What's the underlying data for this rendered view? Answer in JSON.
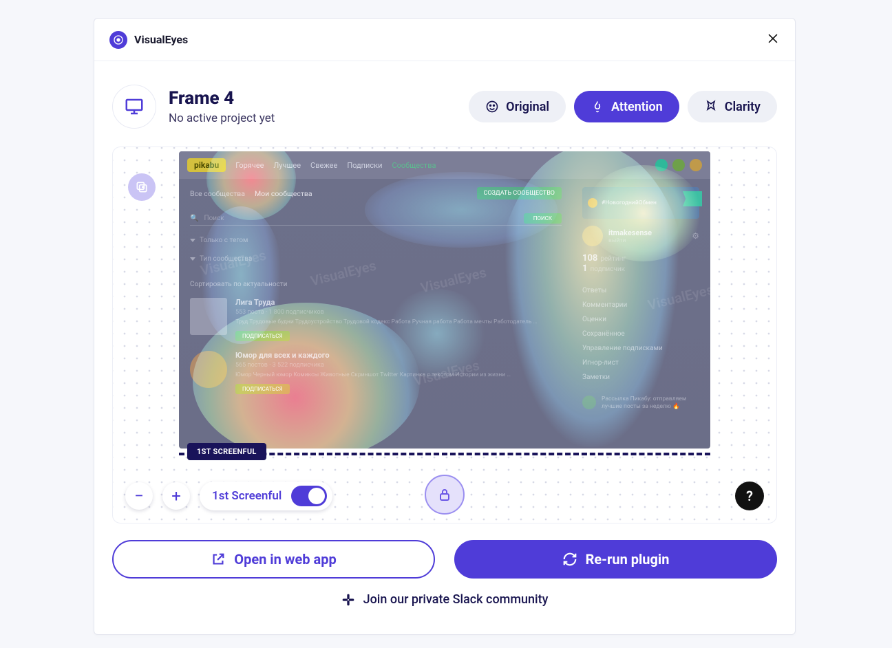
{
  "app": {
    "name": "VisualEyes"
  },
  "header": {
    "title": "Frame 4",
    "subtitle": "No active project yet"
  },
  "tabs": {
    "original": "Original",
    "attention": "Attention",
    "clarity": "Clarity",
    "active": "attention"
  },
  "preview": {
    "screenful_badge": "1ST SCREENFUL",
    "screenful_toggle_label": "1st Screenful",
    "site": {
      "brand": "pikabu",
      "top_nav": [
        "Горячее",
        "Лучшее",
        "Свежее",
        "Подписки",
        "Сообщества"
      ],
      "subnav": {
        "all": "Все сообщества",
        "mine": "Мои сообщества",
        "create": "СОЗДАТЬ СООБЩЕСТВО"
      },
      "search_placeholder": "Поиск",
      "search_btn": "ПОИСК",
      "filters": [
        "Только с тегом",
        "Тип сообщества"
      ],
      "sort": "Сортировать по актуальности",
      "cards": [
        {
          "title": "Лига Труда",
          "meta": "553 поста · 1 800 подписчиков",
          "tags": "Труд   Трудовые будни   Трудоустройство   Трудовой кодекс   Работа   Ручная работа   Работа мечты   Работодатель   …",
          "btn": "ПОДПИСАТЬСЯ"
        },
        {
          "title": "Юмор для всех и каждого",
          "meta": "565 постов · 3 522 подписчика",
          "tags": "Юмор   Черный юмор   Комиксы   Животные   Скриншот   Twitter   Картинка с текстом   Истории из жизни   …",
          "btn": "ПОДПИСАТЬСЯ"
        }
      ],
      "right": {
        "banner": "#НовогоднийОбмен",
        "username": "itmakesense",
        "exit": "выйти",
        "stats": [
          {
            "n": "108",
            "l": "рейтинг"
          },
          {
            "n": "1",
            "l": "подписчик"
          }
        ],
        "menu": [
          "Ответы",
          "Комментарии",
          "Оценки",
          "Сохранённое",
          "Управление подписками",
          "Игнор-лист",
          "Заметки"
        ],
        "mail": "Рассылка Пикабу: отправляем лучшие посты за неделю 🔥"
      },
      "watermark": "VisualEyes"
    }
  },
  "actions": {
    "open": "Open in web app",
    "rerun": "Re-run plugin",
    "slack": "Join our private Slack community"
  },
  "help_label": "?"
}
